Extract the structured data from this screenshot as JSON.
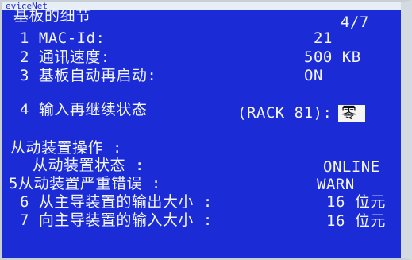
{
  "titlebar": {
    "text": "eviceNet"
  },
  "header": {
    "title": "基板的细节",
    "page": "4/7"
  },
  "items": {
    "mac_id": {
      "label": "1 MAC-Id:",
      "value": "21"
    },
    "speed": {
      "label": "2 通讯速度:",
      "value": "500 KB"
    },
    "auto_restart": {
      "label": "3 基板自动再启动:",
      "value": "ON"
    },
    "input_relay": {
      "label": "4 输入再继续状态",
      "rack": "(RACK 81):",
      "value": "零"
    }
  },
  "slave": {
    "section_title": "从动装置操作 :",
    "status": {
      "label": "从动装置状态 :",
      "value": "ONLINE"
    },
    "severe_error": {
      "label": "5从动装置严重错误 :",
      "value": "WARN"
    },
    "output_size": {
      "label": "6 从主导装置的输出大小 :",
      "value": "16 位元"
    },
    "input_size": {
      "label": "7 向主导装置的输入大小 :",
      "value": "16 位元"
    }
  }
}
